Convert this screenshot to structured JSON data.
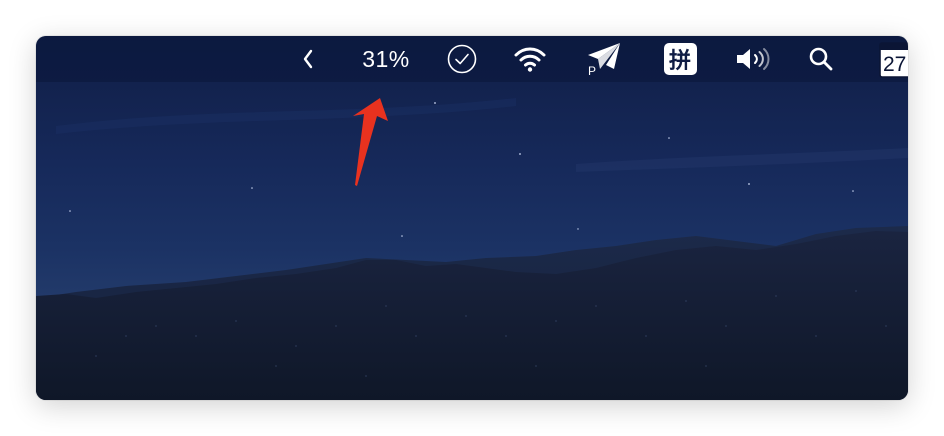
{
  "menubar": {
    "collapse_icon": "chevron-left-icon",
    "battery_percent": "31%",
    "items": [
      {
        "icon": "checkmark-circle-icon"
      },
      {
        "icon": "wifi-icon"
      },
      {
        "icon": "paper-plane-icon",
        "badge": "P"
      },
      {
        "icon": "input-method-icon",
        "label": "拼"
      },
      {
        "icon": "volume-icon"
      },
      {
        "icon": "spotlight-search-icon"
      }
    ],
    "calendar_day": "27"
  },
  "annotation": {
    "icon": "pointer-arrow-icon",
    "color": "#e8321f"
  }
}
